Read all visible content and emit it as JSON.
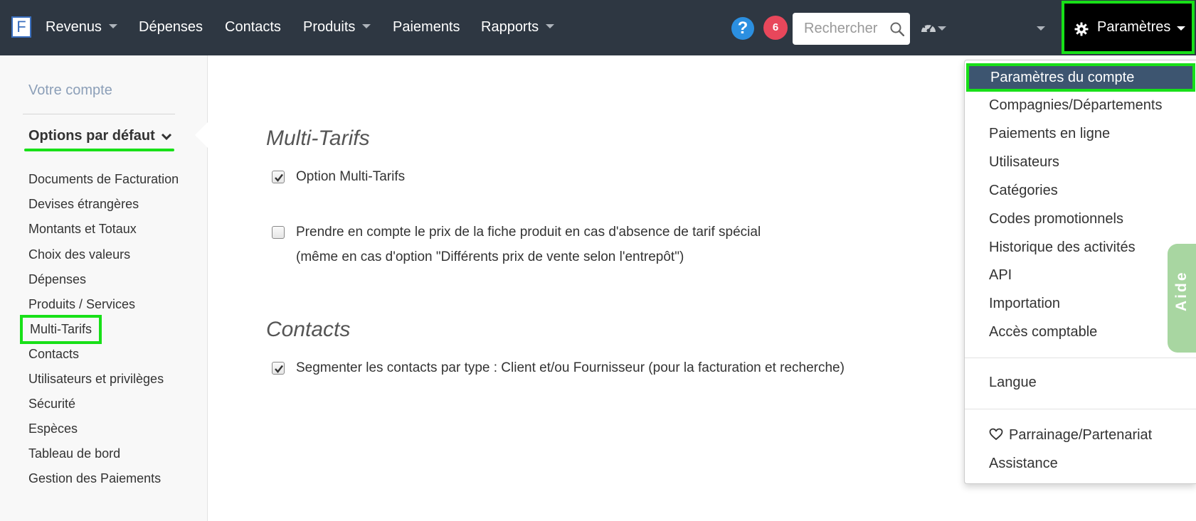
{
  "brand": {
    "logo_letter": "F"
  },
  "nav": {
    "items": [
      {
        "label": "Revenus",
        "has_caret": true
      },
      {
        "label": "Dépenses",
        "has_caret": false
      },
      {
        "label": "Contacts",
        "has_caret": false
      },
      {
        "label": "Produits",
        "has_caret": true
      },
      {
        "label": "Paiements",
        "has_caret": false
      },
      {
        "label": "Rapports",
        "has_caret": true
      }
    ],
    "help_icon": "question-circle-icon",
    "notification_count": "6",
    "search_placeholder": "Rechercher",
    "search_icon": "search-icon",
    "dashboard_icon": "gauge-icon",
    "settings_label": "Paramètres",
    "settings_icon": "gear-icon"
  },
  "sidebar": {
    "account_link": "Votre compte",
    "section_title": "Options par défaut",
    "links": [
      "Documents de Facturation",
      "Devises étrangères",
      "Montants et Totaux",
      "Choix des valeurs",
      "Dépenses",
      "Produits / Services",
      "Multi-Tarifs",
      "Contacts",
      "Utilisateurs et privilèges",
      "Sécurité",
      "Espèces",
      "Tableau de bord",
      "Gestion des Paiements"
    ],
    "active_link": "Multi-Tarifs"
  },
  "main": {
    "sections": [
      {
        "title": "Multi-Tarifs",
        "options": [
          {
            "label": "Option Multi-Tarifs",
            "checked": true
          },
          {
            "label": "Prendre en compte le prix de la fiche produit en cas d'absence de tarif spécial",
            "sublabel": "(même en cas d'option \"Différents prix de vente selon l'entrepôt\")",
            "checked": false
          }
        ]
      },
      {
        "title": "Contacts",
        "options": [
          {
            "label": "Segmenter les contacts par type : Client et/ou Fournisseur (pour la facturation et recherche)",
            "checked": true
          }
        ]
      }
    ]
  },
  "settings_menu": {
    "group1": [
      "Paramètres du compte",
      "Compagnies/Départements",
      "Paiements en ligne",
      "Utilisateurs",
      "Catégories",
      "Codes promotionnels",
      "Historique des activités",
      "API",
      "Importation",
      "Accès comptable"
    ],
    "selected": "Paramètres du compte",
    "group2": [
      "Langue"
    ],
    "group3": [
      {
        "label": "Parrainage/Partenariat",
        "icon": "heart-icon"
      },
      {
        "label": "Assistance",
        "icon": ""
      }
    ]
  },
  "help_tab": {
    "label": "Aide"
  },
  "colors": {
    "topbar": "#2e3742",
    "highlight": "#18e018",
    "menu_selected": "#3d5570",
    "notification": "#e8475b",
    "help_blue": "#2b8fe0",
    "aide_tab": "#a8d6a1"
  }
}
